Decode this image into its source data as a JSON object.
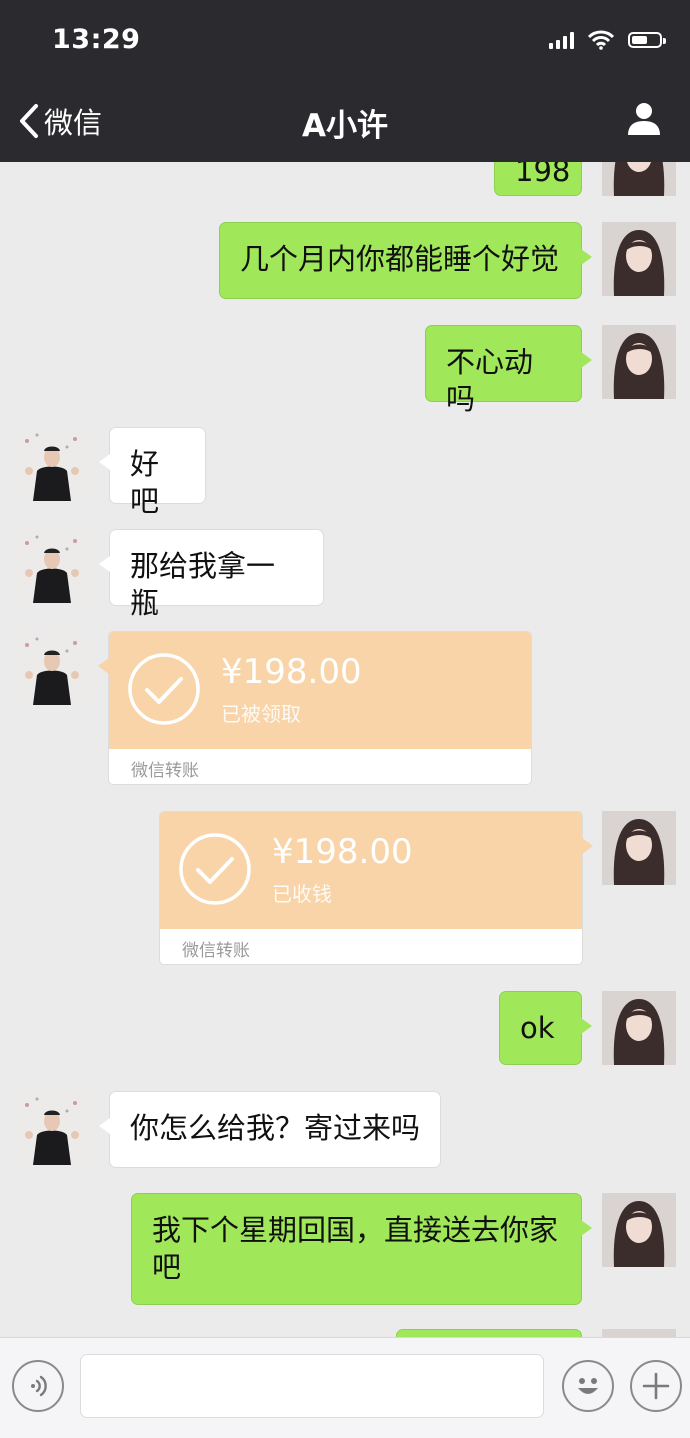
{
  "status_bar": {
    "time": "13:29"
  },
  "nav": {
    "back_label": "微信",
    "title": "A小许",
    "back_icon": "chevron-left-icon",
    "profile_icon": "person-icon"
  },
  "messages": [
    {
      "side": "me",
      "type": "text",
      "text": "198"
    },
    {
      "side": "me",
      "type": "text",
      "text": "几个月内你都能睡个好觉"
    },
    {
      "side": "me",
      "type": "text",
      "text": "不心动吗"
    },
    {
      "side": "them",
      "type": "text",
      "text": "好吧"
    },
    {
      "side": "them",
      "type": "text",
      "text": "那给我拿一瓶"
    },
    {
      "side": "them",
      "type": "transfer",
      "amount": "¥198.00",
      "status": "已被领取",
      "footer": "微信转账"
    },
    {
      "side": "me",
      "type": "transfer",
      "amount": "¥198.00",
      "status": "已收钱",
      "footer": "微信转账"
    },
    {
      "side": "me",
      "type": "text",
      "text": "ok"
    },
    {
      "side": "them",
      "type": "text",
      "text": "你怎么给我？寄过来吗"
    },
    {
      "side": "me",
      "type": "text",
      "text": "我下个星期回国，直接送去你家吧"
    }
  ],
  "input_bar": {
    "voice_icon": "voice-icon",
    "emoji_icon": "emoji-icon",
    "plus_icon": "plus-icon",
    "placeholder": ""
  },
  "colors": {
    "header_bg": "#2b2a2f",
    "chat_bg": "#ebebeb",
    "my_bubble": "#a0e75a",
    "their_bubble": "#ffffff",
    "transfer_bg": "#f8d4a8"
  }
}
